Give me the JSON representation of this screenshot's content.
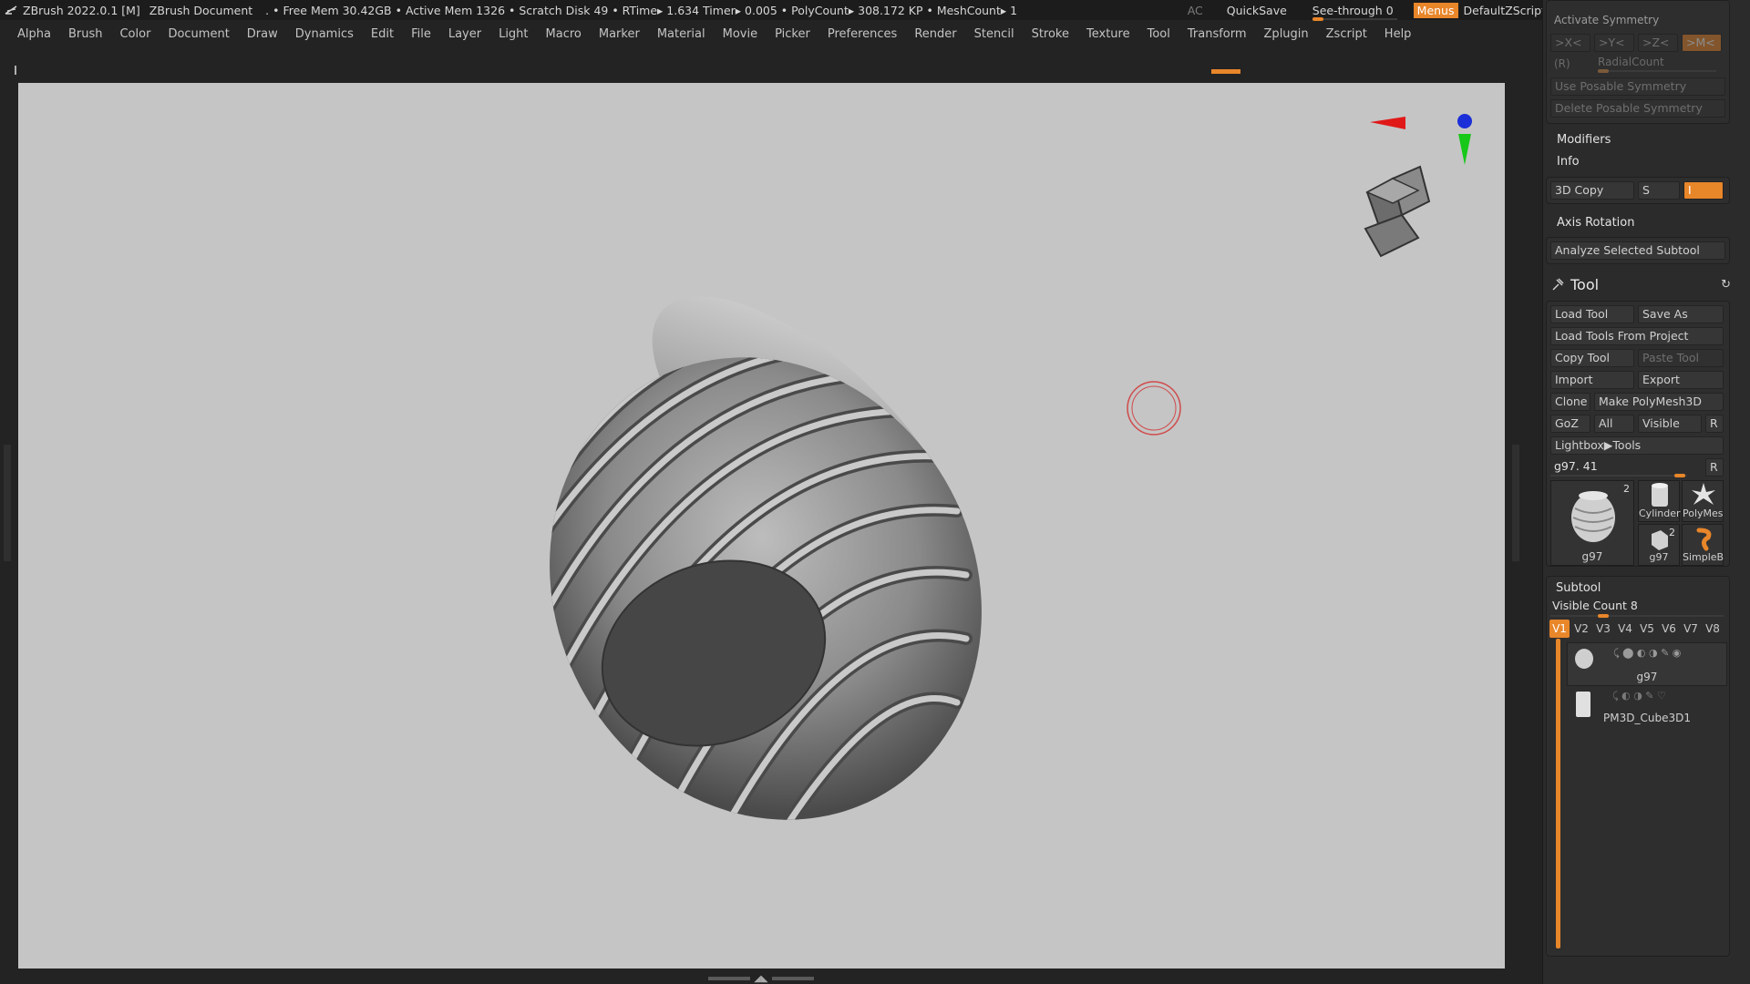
{
  "titlebar": {
    "app": "ZBrush 2022.0.1 [M]",
    "doc": "ZBrush Document",
    "stats": ". • Free Mem 30.42GB • Active Mem 1326 • Scratch Disk 49 •  RTime▸ 1.634 Timer▸ 0.005 • PolyCount▸ 308.172 KP  • MeshCount▸ 1",
    "ac": "AC",
    "quicksave": "QuickSave",
    "see_through": "See-through  0",
    "see_through_value": 0,
    "menus": "Menus",
    "script": "DefaultZScript",
    "window_icons": [
      "sound-wave-icon",
      "tray-icon",
      "layout-icon",
      "popout-icon",
      "minimize-icon",
      "restore-icon",
      "close-icon"
    ],
    "minimize": "−",
    "restore": "❐",
    "close": "✕"
  },
  "menubar": [
    "Alpha",
    "Brush",
    "Color",
    "Document",
    "Draw",
    "Dynamics",
    "Edit",
    "File",
    "Layer",
    "Light",
    "Macro",
    "Marker",
    "Material",
    "Movie",
    "Picker",
    "Preferences",
    "Render",
    "Stencil",
    "Stroke",
    "Texture",
    "Tool",
    "Transform",
    "Zplugin",
    "Zscript",
    "Help"
  ],
  "panel": {
    "symmetry": {
      "header": "Activate Symmetry",
      "x": ">X<",
      "y": ">Y<",
      "z": ">Z<",
      "m": ">M<",
      "r": "(R)",
      "radial": "RadialCount",
      "use_posable": "Use Posable Symmetry",
      "delete_posable": "Delete Posable Symmetry"
    },
    "modifiers": "Modifiers",
    "info": "Info",
    "copy3d": "3D Copy",
    "copy3d_s": "S",
    "copy3d_i": "I",
    "axis_rotation": "Axis Rotation",
    "analyze": "Analyze Selected Subtool",
    "tool": {
      "title": "Tool",
      "load_tool": "Load Tool",
      "save_as": "Save As",
      "load_from_project": "Load Tools From Project",
      "copy_tool": "Copy Tool",
      "paste_tool": "Paste Tool",
      "import": "Import",
      "export": "Export",
      "clone": "Clone",
      "make_polymesh": "Make PolyMesh3D",
      "goz": "GoZ",
      "all": "All",
      "visible": "Visible",
      "r": "R",
      "lightbox": "Lightbox▶Tools",
      "current": "g97. 41",
      "current_r": "R",
      "thumbs": [
        {
          "label": "g97",
          "count": "2"
        },
        {
          "label": "Cylinder"
        },
        {
          "label": "PolyMes"
        },
        {
          "label": "g97",
          "count": "2"
        },
        {
          "label": "SimpleB"
        }
      ]
    },
    "subtool": {
      "title": "Subtool",
      "visible_count": "Visible Count 8",
      "tabs": [
        "V1",
        "V2",
        "V3",
        "V4",
        "V5",
        "V6",
        "V7",
        "V8"
      ],
      "selected_tab": "V1",
      "items": [
        {
          "name": "g97"
        },
        {
          "name": "PM3D_Cube3D1"
        }
      ]
    }
  },
  "colors": {
    "accent": "#e8862a",
    "viewport_bg": "#c5c5c5",
    "panel_bg": "#2b2b2b",
    "cursor_ring": "#d04a4a"
  }
}
